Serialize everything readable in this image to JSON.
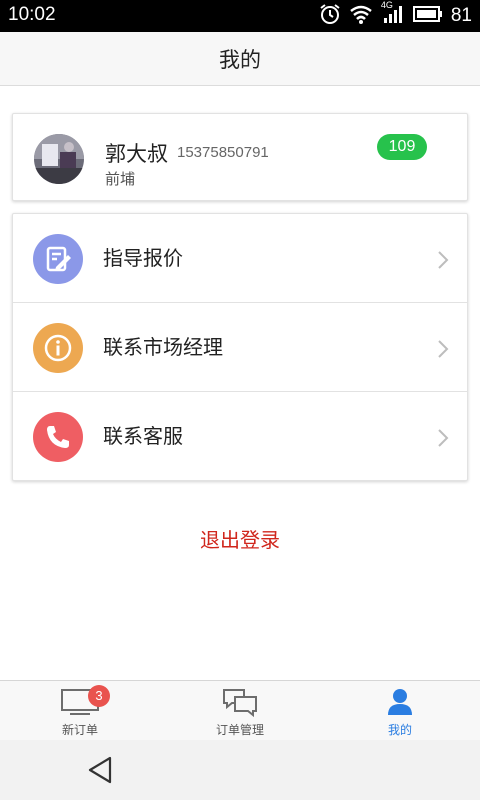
{
  "status_bar": {
    "time": "10:02",
    "network": "4G",
    "battery": "81",
    "icons": [
      "alarm-icon",
      "wifi-icon",
      "signal-icon",
      "battery-icon"
    ]
  },
  "header": {
    "title": "我的"
  },
  "profile": {
    "name": "郭大叔",
    "phone": "15375850791",
    "location": "前埔",
    "badge": "109",
    "badge_color": "#27c24c"
  },
  "menu": {
    "items": [
      {
        "label": "指导报价",
        "icon": "edit-icon",
        "color": "#8b98e8"
      },
      {
        "label": "联系市场经理",
        "icon": "info-icon",
        "color": "#eda851"
      },
      {
        "label": "联系客服",
        "icon": "phone-icon",
        "color": "#ef5e63"
      }
    ]
  },
  "logout": {
    "label": "退出登录",
    "color": "#d0261c"
  },
  "tabs": [
    {
      "label": "新订单",
      "icon": "monitor-icon",
      "badge": "3"
    },
    {
      "label": "订单管理",
      "icon": "chat-icon"
    },
    {
      "label": "我的",
      "icon": "person-icon",
      "active": true
    }
  ],
  "colors": {
    "accent": "#2a7de1",
    "notification": "#e9534e"
  }
}
